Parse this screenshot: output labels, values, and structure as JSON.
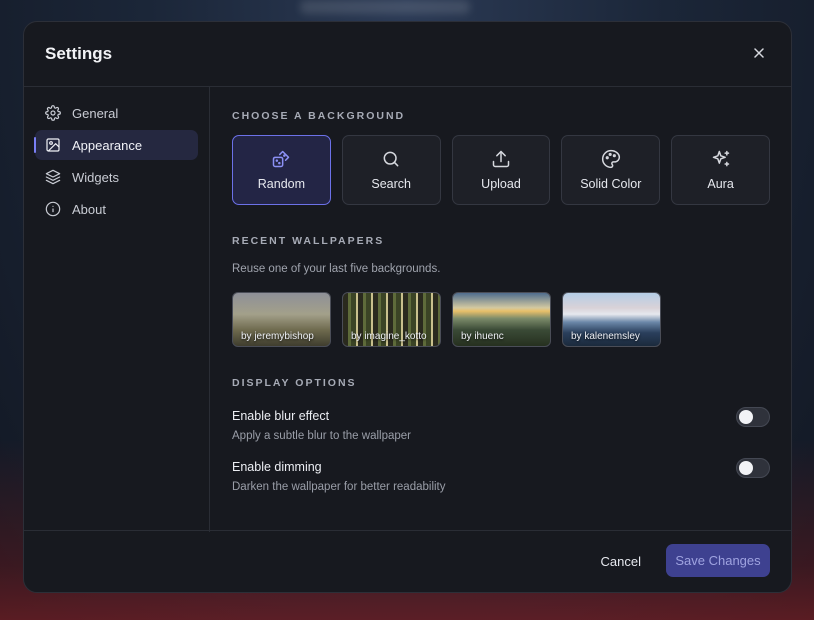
{
  "dialog": {
    "title": "Settings"
  },
  "sidebar": {
    "items": [
      {
        "label": "General",
        "icon": "gear-icon"
      },
      {
        "label": "Appearance",
        "icon": "image-icon",
        "active": true
      },
      {
        "label": "Widgets",
        "icon": "layers-icon"
      },
      {
        "label": "About",
        "icon": "info-icon"
      }
    ]
  },
  "background": {
    "heading": "CHOOSE A BACKGROUND",
    "options": [
      {
        "label": "Random",
        "icon": "dice-icon",
        "active": true
      },
      {
        "label": "Search",
        "icon": "search-icon"
      },
      {
        "label": "Upload",
        "icon": "upload-icon"
      },
      {
        "label": "Solid Color",
        "icon": "palette-icon"
      },
      {
        "label": "Aura",
        "icon": "sparkles-icon"
      }
    ]
  },
  "recent": {
    "heading": "RECENT WALLPAPERS",
    "description": "Reuse one of your last five backgrounds.",
    "items": [
      {
        "credit": "by jeremybishop"
      },
      {
        "credit": "by imagine_kotto"
      },
      {
        "credit": "by ihuenc"
      },
      {
        "credit": "by kalenemsley"
      }
    ]
  },
  "display": {
    "heading": "DISPLAY OPTIONS",
    "blur": {
      "title": "Enable blur effect",
      "description": "Apply a subtle blur to the wallpaper",
      "enabled": false
    },
    "dimming": {
      "title": "Enable dimming",
      "description": "Darken the wallpaper for better readability",
      "enabled": false
    }
  },
  "footer": {
    "cancel_label": "Cancel",
    "save_label": "Save Changes"
  },
  "colors": {
    "accent": "#6c71e8",
    "save_button_bg": "#3e4190",
    "modal_bg": "#17191f"
  }
}
